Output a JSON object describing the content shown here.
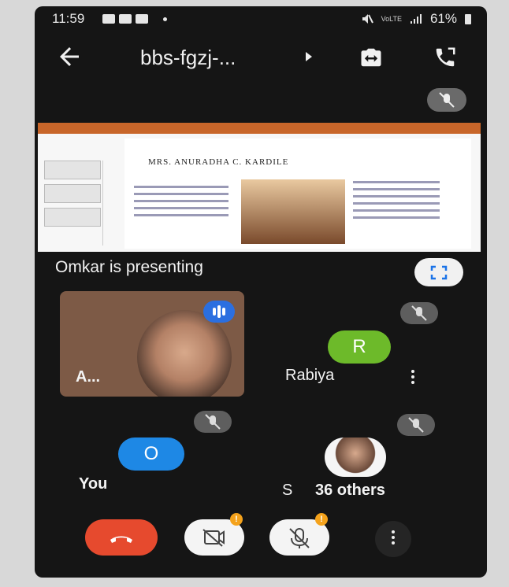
{
  "status_bar": {
    "time": "11:59",
    "battery": "61%",
    "network": "VoLTE"
  },
  "meeting": {
    "code": "bbs-fgzj-..."
  },
  "presentation": {
    "presenter_text": "Omkar is presenting",
    "doc_name": "MRS. ANURADHA C. KARDILE"
  },
  "participants": [
    {
      "name": "A...",
      "speaking": true
    },
    {
      "name": "Rabiya",
      "initial": "R",
      "avatar_color": "#6dba2a",
      "muted": true
    },
    {
      "name": "You",
      "initial": "O",
      "avatar_color": "#1e88e5",
      "muted": true
    },
    {
      "name": "S",
      "others_label": "36 others",
      "muted": true
    }
  ],
  "colors": {
    "end_call": "#e64a2e",
    "badge": "#f4a21b",
    "speaking": "#2b6fe0"
  },
  "icons": {
    "back": "arrow-left-icon",
    "caret": "caret-right-icon",
    "switch_camera": "switch-camera-icon",
    "call": "call-audio-icon",
    "mic_off": "mic-off-icon",
    "fullscreen": "fullscreen-icon",
    "end_call": "phone-hangup-icon",
    "cam_off": "camera-off-icon",
    "more": "more-vert-icon"
  },
  "controls": {
    "cam_badge": "!",
    "mic_badge": "!"
  }
}
